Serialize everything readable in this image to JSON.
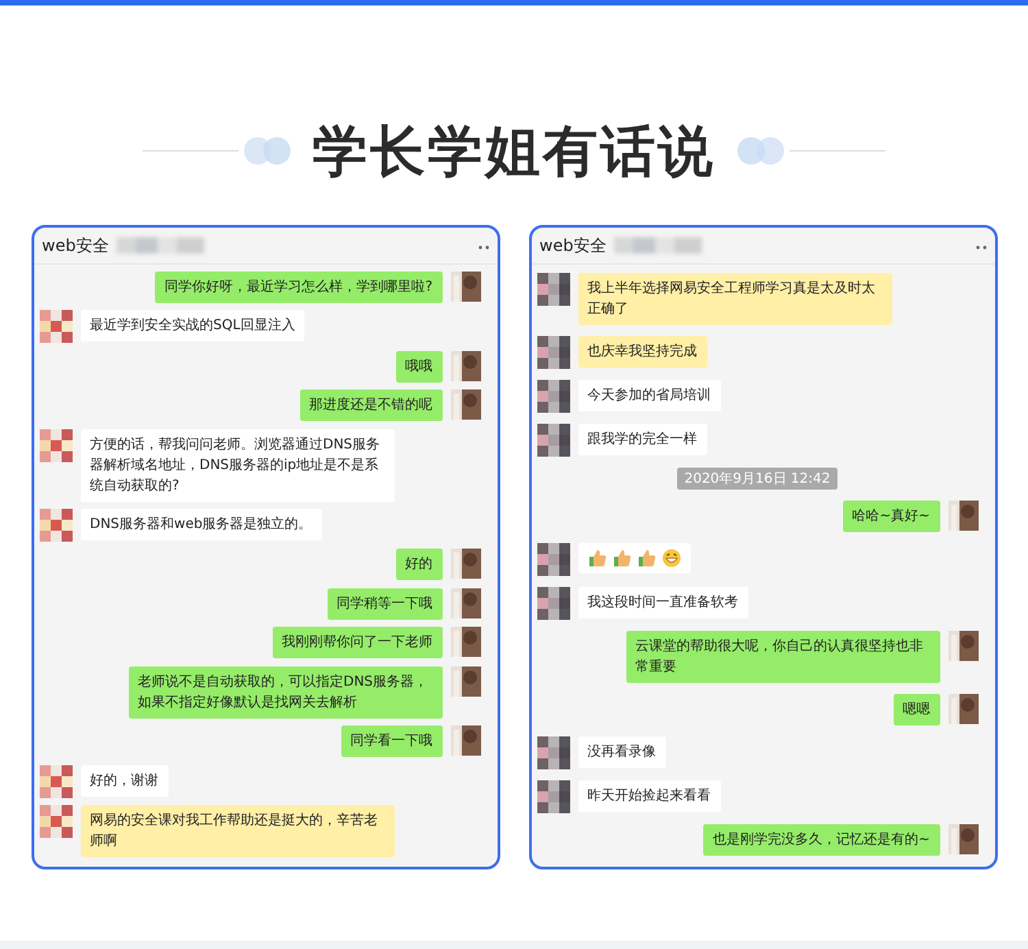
{
  "heading": "学长学姐有话说",
  "chats": [
    {
      "title": "web安全",
      "items": [
        {
          "kind": "message",
          "outgoing": true,
          "text": "同学你好呀，最近学习怎么样，学到哪里啦?",
          "highlighted": false
        },
        {
          "kind": "message",
          "outgoing": false,
          "text": "最近学到安全实战的SQL回显注入",
          "highlighted": false
        },
        {
          "kind": "message",
          "outgoing": true,
          "text": "哦哦",
          "highlighted": false
        },
        {
          "kind": "message",
          "outgoing": true,
          "text": "那进度还是不错的呢",
          "highlighted": false
        },
        {
          "kind": "message",
          "outgoing": false,
          "text": "方便的话，帮我问问老师。浏览器通过DNS服务器解析域名地址，DNS服务器的ip地址是不是系统自动获取的?",
          "highlighted": false
        },
        {
          "kind": "message",
          "outgoing": false,
          "text": "DNS服务器和web服务器是独立的。",
          "highlighted": false
        },
        {
          "kind": "message",
          "outgoing": true,
          "text": "好的",
          "highlighted": false
        },
        {
          "kind": "message",
          "outgoing": true,
          "text": "同学稍等一下哦",
          "highlighted": false
        },
        {
          "kind": "message",
          "outgoing": true,
          "text": "我刚刚帮你问了一下老师",
          "highlighted": false
        },
        {
          "kind": "message",
          "outgoing": true,
          "text": "老师说不是自动获取的，可以指定DNS服务器，如果不指定好像默认是找网关去解析",
          "highlighted": false
        },
        {
          "kind": "message",
          "outgoing": true,
          "text": "同学看一下哦",
          "highlighted": false
        },
        {
          "kind": "message",
          "outgoing": false,
          "text": "好的，谢谢",
          "highlighted": false
        },
        {
          "kind": "message",
          "outgoing": false,
          "text": "网易的安全课对我工作帮助还是挺大的，辛苦老师啊",
          "highlighted": true
        }
      ]
    },
    {
      "title": "web安全",
      "items": [
        {
          "kind": "message",
          "outgoing": false,
          "text": "我上半年选择网易安全工程师学习真是太及时太正确了",
          "highlighted": true
        },
        {
          "kind": "message",
          "outgoing": false,
          "text": "也庆幸我坚持完成",
          "highlighted": true
        },
        {
          "kind": "message",
          "outgoing": false,
          "text": "今天参加的省局培训",
          "highlighted": false
        },
        {
          "kind": "message",
          "outgoing": false,
          "text": "跟我学的完全一样",
          "highlighted": false
        },
        {
          "kind": "time",
          "text": "2020年9月16日 12:42"
        },
        {
          "kind": "message",
          "outgoing": true,
          "text": "哈哈~真好~",
          "highlighted": false
        },
        {
          "kind": "emoji",
          "outgoing": false,
          "emojis": [
            {
              "kind": "thumbs-up"
            },
            {
              "kind": "thumbs-up"
            },
            {
              "kind": "thumbs-up"
            },
            {
              "kind": "grin"
            }
          ]
        },
        {
          "kind": "message",
          "outgoing": false,
          "text": "我这段时间一直准备软考",
          "highlighted": false
        },
        {
          "kind": "message",
          "outgoing": true,
          "text": "云课堂的帮助很大呢，你自己的认真很坚持也非常重要",
          "highlighted": false
        },
        {
          "kind": "message",
          "outgoing": true,
          "text": "嗯嗯",
          "highlighted": false
        },
        {
          "kind": "message",
          "outgoing": false,
          "text": "没再看录像",
          "highlighted": false
        },
        {
          "kind": "message",
          "outgoing": false,
          "text": "昨天开始捡起来看看",
          "highlighted": false
        },
        {
          "kind": "message",
          "outgoing": true,
          "text": "也是刚学完没多久，记忆还是有的~",
          "highlighted": false
        }
      ]
    }
  ]
}
